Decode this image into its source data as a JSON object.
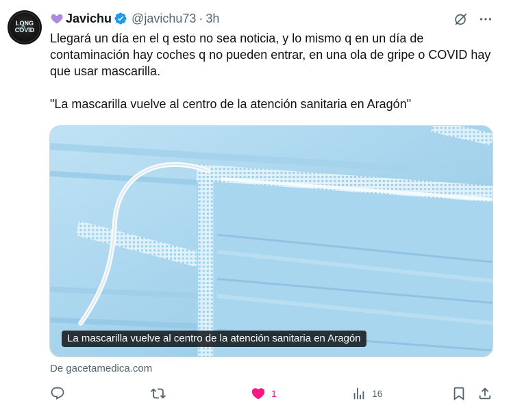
{
  "tweet": {
    "display_name": "Javichu",
    "handle": "@javichu73",
    "separator": "·",
    "time": "3h",
    "avatar_text": {
      "line1": "LONG",
      "line2": "COVID"
    },
    "text_paragraphs": [
      "Llegará un día en el q esto no sea noticia, y lo mismo q en un día de contaminación hay coches q no pueden entrar, en una ola de gripe o COVID hay que usar mascarilla.",
      "\"La mascarilla vuelve al centro de la atención sanitaria en Aragón\""
    ]
  },
  "card": {
    "caption": "La mascarilla vuelve al centro de la atención sanitaria en Aragón",
    "source": "De gacetamedica.com"
  },
  "actions": {
    "reply_count": "",
    "retweet_count": "",
    "like_count": "1",
    "views_count": "16"
  },
  "icons": {
    "name_prefix": "purple-heart-icon",
    "verified": "verified-badge-icon",
    "grok": "grok-icon",
    "more": "more-icon",
    "reply": "reply-icon",
    "retweet": "retweet-icon",
    "like": "like-icon",
    "views": "views-icon",
    "bookmark": "bookmark-icon",
    "share": "share-icon"
  },
  "colors": {
    "like_active": "#f91880",
    "verified": "#1d9bf0",
    "secondary_text": "#536471",
    "purple_heart": "#a98be3"
  }
}
